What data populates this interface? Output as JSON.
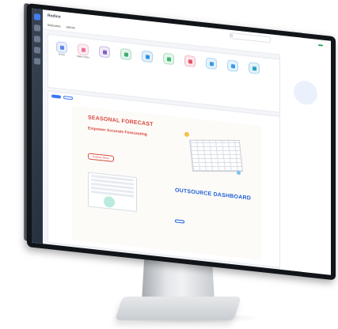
{
  "topbar": {
    "brand": "Redico",
    "search_placeholder": "Q",
    "status_pill": "",
    "user_label": ""
  },
  "subbar": {
    "tabs": [
      "Welcome",
      "Admin"
    ]
  },
  "quick_access": {
    "title": "",
    "apps": [
      {
        "label": "Home",
        "color": "#4c7be8"
      },
      {
        "label": "Make Order",
        "color": "#e86a8f"
      },
      {
        "label": "",
        "color": "#7e57c2"
      },
      {
        "label": "",
        "color": "#36a86b"
      },
      {
        "label": "",
        "color": "#2a8fe3"
      },
      {
        "label": "",
        "color": "#3bb56a"
      },
      {
        "label": "",
        "color": "#e0566b"
      },
      {
        "label": "",
        "color": "#3b9ae8"
      },
      {
        "label": "",
        "color": "#3b9ae8"
      },
      {
        "label": "",
        "color": "#2aa2c7"
      }
    ]
  },
  "panel": {
    "chips": [
      "",
      ""
    ],
    "forecast": {
      "title": "SEASONAL FORECAST",
      "subtitle": "Empower Accurate Forecasting",
      "body": "",
      "button": "Explore More"
    },
    "dashboard": {
      "title": "OUTSOURCE DASHBOARD",
      "subtitle": "",
      "body": "",
      "button": ""
    }
  },
  "right_pane": {
    "title": "",
    "empty_text": ""
  },
  "colors": {
    "accent": "#2a6df4",
    "forecast_red": "#d5463a",
    "dashboard_blue": "#1f5fd6",
    "rail": "#1f2a3a"
  }
}
